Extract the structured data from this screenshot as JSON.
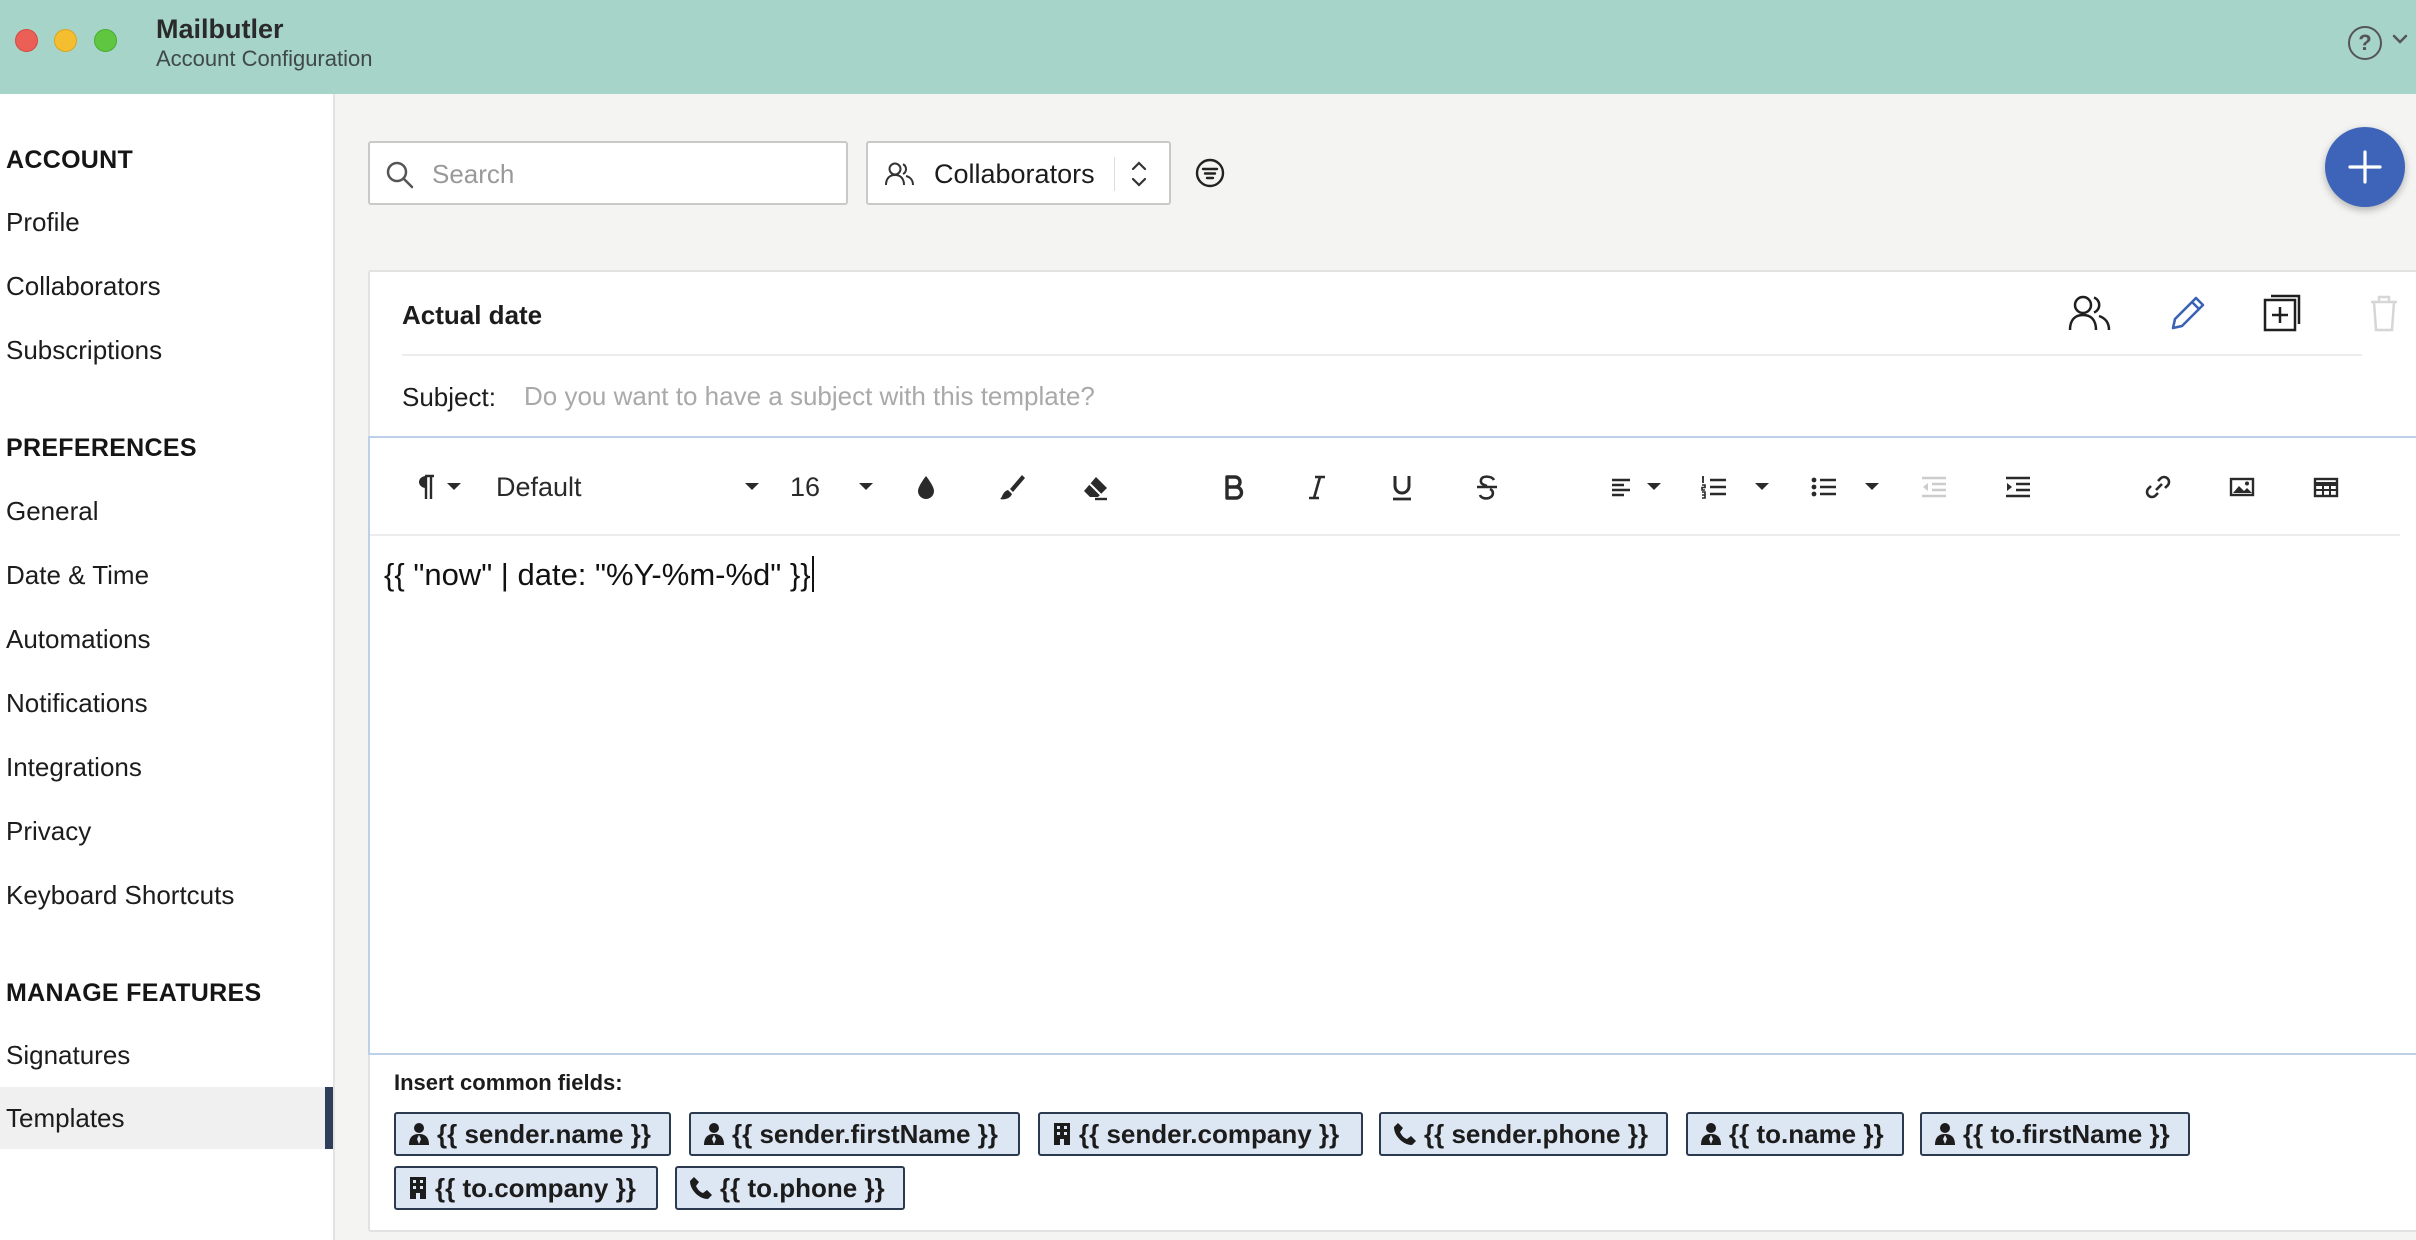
{
  "app": {
    "title": "Mailbutler",
    "subtitle": "Account Configuration",
    "help_label": "?"
  },
  "sidebar": {
    "sections": [
      {
        "title": "ACCOUNT",
        "items": [
          "Profile",
          "Collaborators",
          "Subscriptions"
        ]
      },
      {
        "title": "PREFERENCES",
        "items": [
          "General",
          "Date & Time",
          "Automations",
          "Notifications",
          "Integrations",
          "Privacy",
          "Keyboard Shortcuts"
        ]
      },
      {
        "title": "MANAGE FEATURES",
        "items": [
          "Signatures",
          "Templates"
        ]
      }
    ],
    "active_item": "Templates"
  },
  "toolbar": {
    "search_placeholder": "Search",
    "search_value": "",
    "filter_select_value": "Collaborators"
  },
  "template": {
    "name": "Actual date",
    "subject_label": "Subject:",
    "subject_placeholder": "Do you want to have a subject with this template?",
    "subject_value": "",
    "body": "{{ \"now\" | date: \"%Y-%m-%d\" }}"
  },
  "editor_toolbar": {
    "font_family": "Default",
    "font_size": "16"
  },
  "fields": {
    "label": "Insert common fields:",
    "chips": [
      {
        "text": "{{ sender.name }}",
        "icon": "person-icon"
      },
      {
        "text": "{{ sender.firstName }}",
        "icon": "person-icon"
      },
      {
        "text": "{{ sender.company }}",
        "icon": "building-icon"
      },
      {
        "text": "{{ sender.phone }}",
        "icon": "phone-icon"
      },
      {
        "text": "{{ to.name }}",
        "icon": "person-icon"
      },
      {
        "text": "{{ to.firstName }}",
        "icon": "person-icon"
      },
      {
        "text": "{{ to.company }}",
        "icon": "building-icon"
      },
      {
        "text": "{{ to.phone }}",
        "icon": "phone-icon"
      }
    ]
  },
  "colors": {
    "titlebar": "#a6d4c8",
    "accent": "#3d64b8",
    "chip_bg": "#dde6f3",
    "active_marker": "#2f3f5a"
  }
}
